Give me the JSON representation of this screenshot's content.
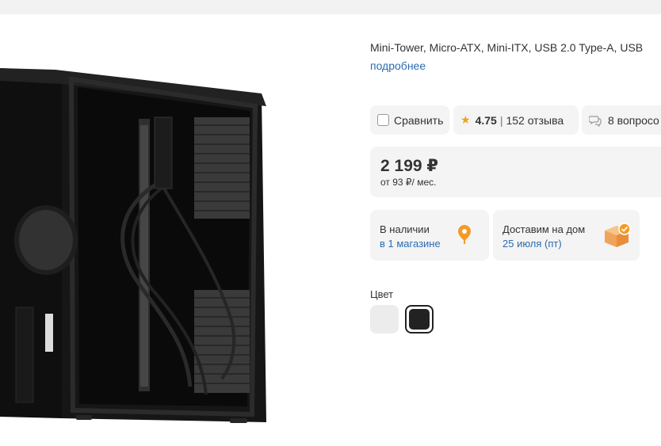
{
  "product": {
    "specs": "Mini-Tower, Micro-ATX, Mini-ITX, USB 2.0 Type-A, USB",
    "more_link": "подробнее",
    "image_icon": "pc-case-image"
  },
  "actions": {
    "compare_label": "Сравнить",
    "rating_value": "4.75",
    "rating_separator": "|",
    "reviews_label": "152 отзыва",
    "questions_label": "8 вопросо"
  },
  "price": {
    "value": "2 199 ₽",
    "installment": "от 93 ₽/ мес."
  },
  "availability": {
    "title": "В наличии",
    "detail": "в 1 магазине",
    "icon": "location-pin-icon",
    "icon_color": "#f59a23"
  },
  "delivery": {
    "title": "Доставим на дом",
    "date": "25 июля (пт)",
    "icon": "package-check-icon"
  },
  "color": {
    "label": "Цвет",
    "options": [
      {
        "name": "white",
        "hex": "#ececec",
        "selected": false
      },
      {
        "name": "black",
        "hex": "#222222",
        "selected": true
      }
    ]
  },
  "theme": {
    "link_color": "#2b6cb0",
    "pill_bg": "#f4f4f4",
    "star_color": "#f0a020"
  }
}
